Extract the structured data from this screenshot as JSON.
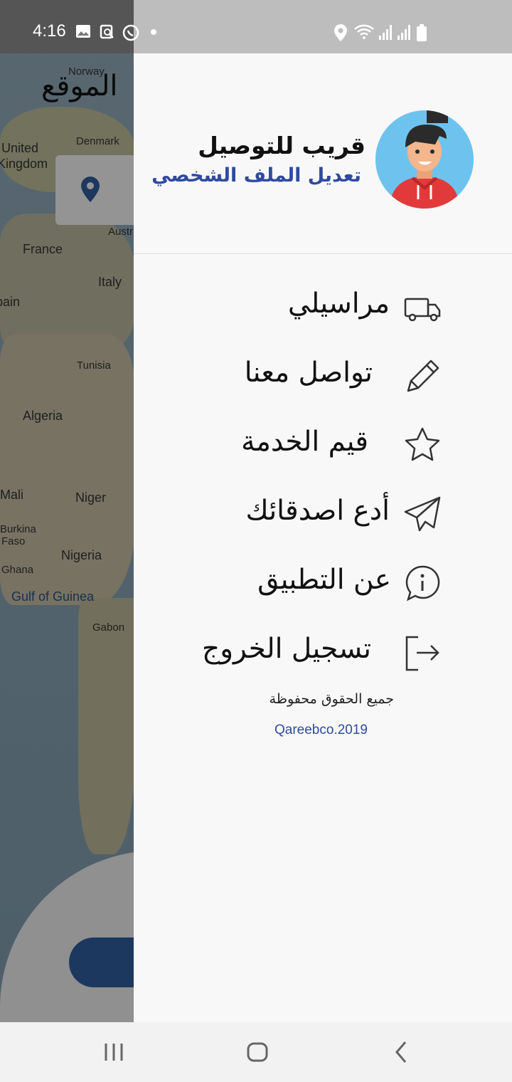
{
  "status_bar": {
    "time": "4:16",
    "icons": [
      "gallery-icon",
      "screenshot-icon",
      "whatsapp-icon",
      "dot-icon",
      "location-icon",
      "wifi-icon",
      "signal-icon",
      "signal-icon",
      "battery-icon"
    ]
  },
  "background": {
    "title": "الموقع",
    "map_labels": [
      "Norway",
      "Denmark",
      "United Kingdom",
      "France",
      "Italy",
      "Austr",
      "Spain",
      "Tunisia",
      "Algeria",
      "Mali",
      "Niger",
      "Burkina Faso",
      "Nigeria",
      "Ghana",
      "Gulf of Guinea",
      "Gabon"
    ]
  },
  "drawer": {
    "header": {
      "title": "قريب للتوصيل",
      "edit_profile": "تعديل الملف الشخصي"
    },
    "menu": [
      {
        "label": "مراسيلي",
        "icon": "truck-icon"
      },
      {
        "label": "تواصل معنا",
        "icon": "pencil-icon"
      },
      {
        "label": "قيم الخدمة",
        "icon": "star-icon"
      },
      {
        "label": "أدع اصدقائك",
        "icon": "paper-plane-icon"
      },
      {
        "label": "عن التطبيق",
        "icon": "info-bubble-icon"
      },
      {
        "label": "تسجيل الخروج",
        "icon": "logout-icon"
      }
    ],
    "footer": {
      "rights": "جميع الحقوق محفوظة",
      "copyright": "Qareebco.2019"
    }
  },
  "colors": {
    "accent_blue": "#2f4aa1",
    "drawer_bg": "#f8f8f8",
    "avatar_bg": "#6ec3ee"
  }
}
